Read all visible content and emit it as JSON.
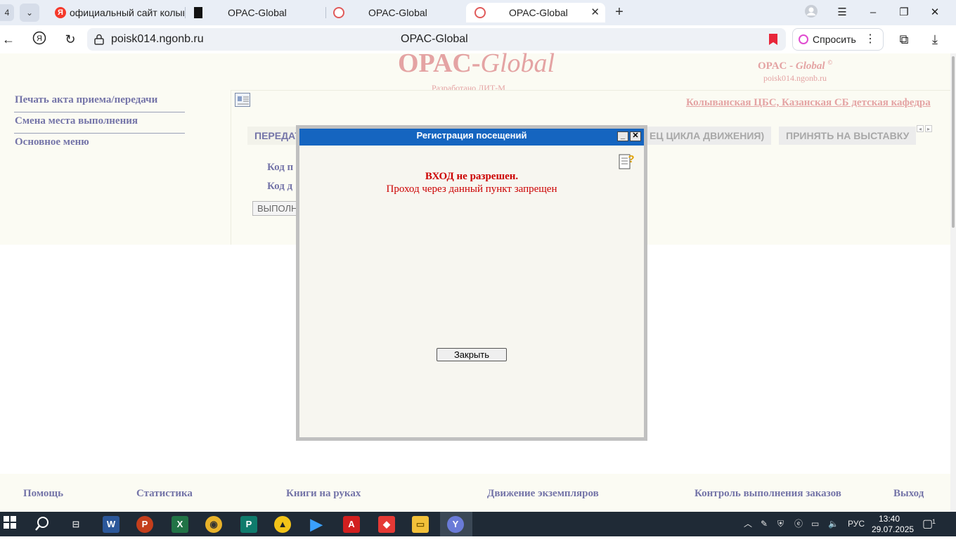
{
  "browser": {
    "tab_count": "4",
    "tabs": [
      {
        "title": "официальный сайт колыв"
      },
      {
        "title": ""
      },
      {
        "title": "OPAC-Global"
      },
      {
        "title": "OPAC-Global"
      },
      {
        "title": "OPAC-Global"
      }
    ],
    "address": {
      "url": "poisk014.ngonb.ru",
      "page_title": "OPAC-Global"
    },
    "ask_button": "Спросить"
  },
  "header": {
    "logo_main": "OPAC-",
    "logo_italic": "Global",
    "logo_sub": "Разработано ЛИТ-М",
    "brand_text": "OPAC - ",
    "brand_italic": "Global",
    "brand_mark": "©",
    "brand_url": "poisk014.ngonb.ru"
  },
  "sidebar": {
    "items": [
      {
        "label": "Печать акта приема/передачи"
      },
      {
        "label": "Смена места выполнения"
      },
      {
        "label": "Основное меню"
      }
    ]
  },
  "content": {
    "org_link": "Колыванская ЦБС, Казанская СБ детская кафедра",
    "tabs": [
      {
        "label": "ПЕРЕДАТ"
      },
      {
        "label": "ЕЦ ЦИКЛА ДВИЖЕНИЯ)"
      },
      {
        "label": "ПРИНЯТЬ НА ВЫСТАВКУ"
      }
    ],
    "field_1": "Код п",
    "field_2": "Код д",
    "execute_button": "ВЫПОЛН"
  },
  "footer": {
    "links": [
      {
        "label": "Помощь"
      },
      {
        "label": "Статистика"
      },
      {
        "label": "Книги на руках"
      },
      {
        "label": "Движение экземпляров"
      },
      {
        "label": "Контроль выполнения заказов"
      },
      {
        "label": "Выход"
      }
    ]
  },
  "dialog": {
    "title": "Регистрация посещений",
    "message_title": "ВХОД не разрешен.",
    "message_text": "Проход через данный пункт запрещен",
    "close_button": "Закрыть"
  },
  "taskbar": {
    "language": "РУС",
    "time": "13:40",
    "date": "29.07.2025",
    "notification_count": "1"
  },
  "colors": {
    "link_purple": "#7474a8",
    "faded_pink": "#e4a3a3",
    "dialog_title_blue": "#1565c0",
    "error_red": "#cc0000"
  }
}
